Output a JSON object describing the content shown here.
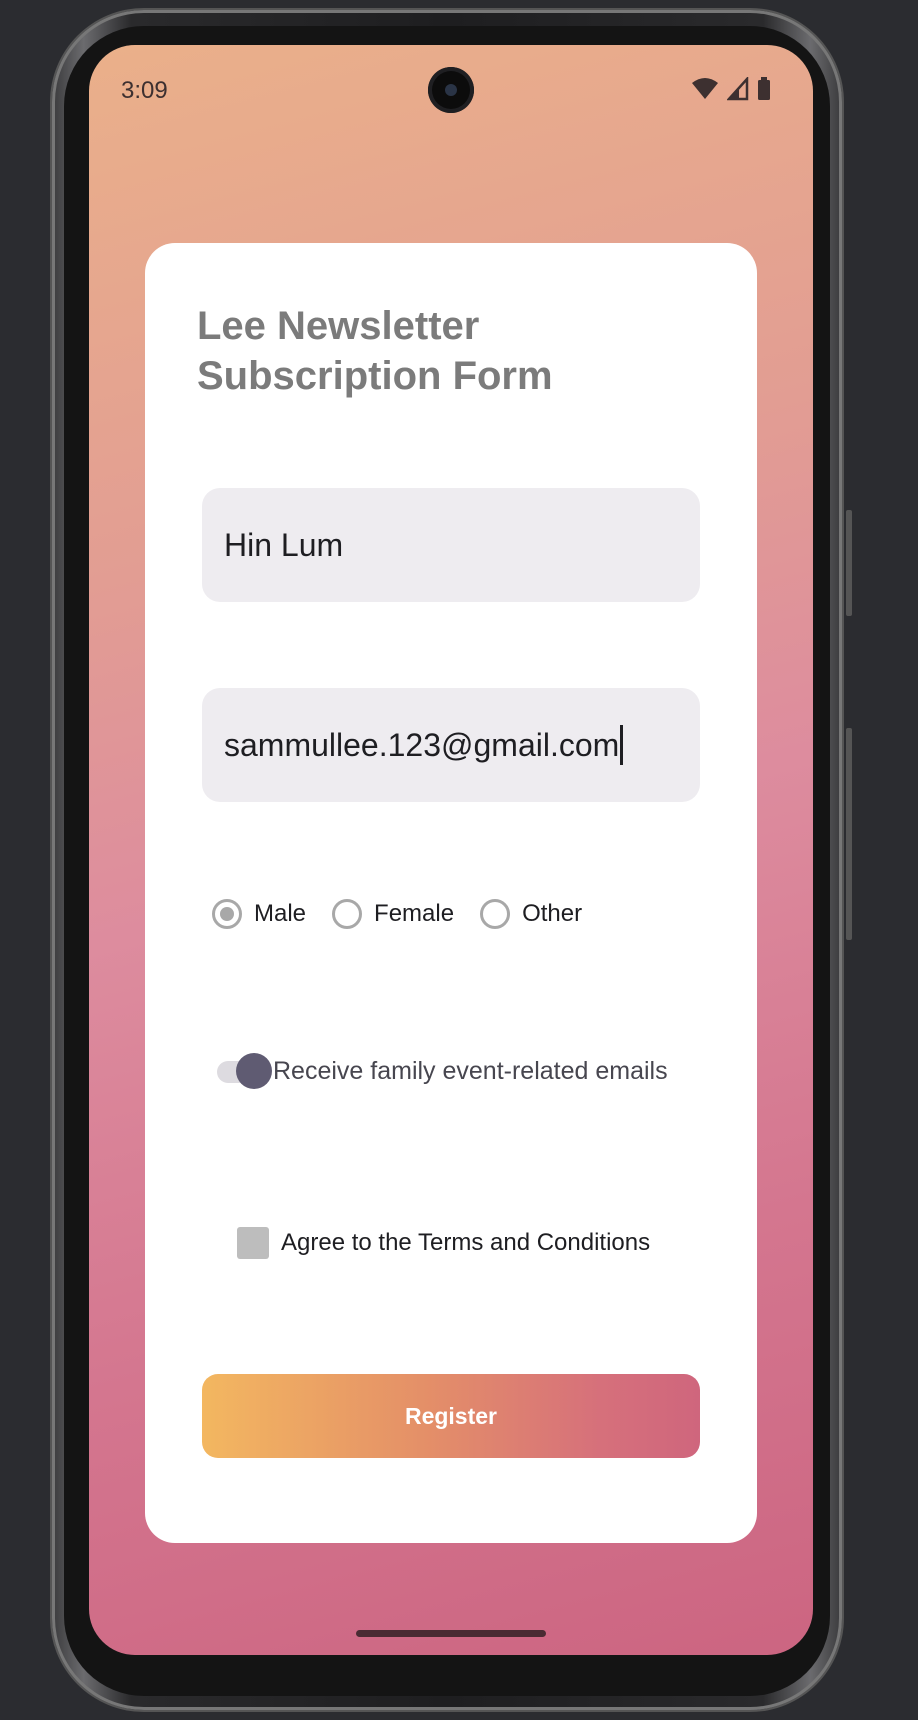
{
  "status_bar": {
    "time": "3:09"
  },
  "form": {
    "title": "Lee Newsletter Subscription Form",
    "name_value": "Hin Lum",
    "email_value": "sammullee.123@gmail.com",
    "gender_options": [
      "Male",
      "Female",
      "Other"
    ],
    "gender_selected": "Male",
    "family_emails_label": "Receive family event-related emails",
    "family_emails_on": true,
    "terms_label": "Agree to the Terms and Conditions",
    "terms_checked": false,
    "register_label": "Register"
  },
  "colors": {
    "background_top": "#eab08a",
    "background_bottom": "#cc6581",
    "button_start": "#f3b760",
    "button_end": "#cf667d",
    "title": "#7b7b7b",
    "switch_thumb": "#5f5b72"
  }
}
